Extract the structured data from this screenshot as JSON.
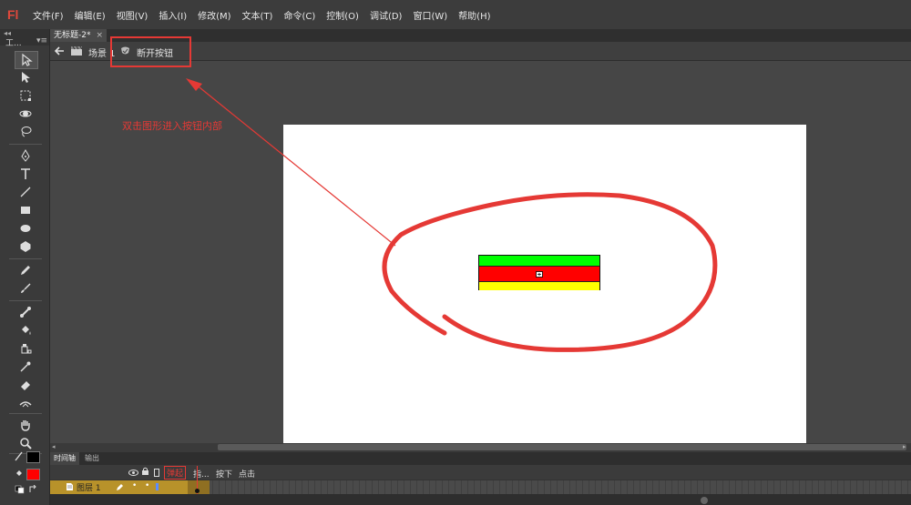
{
  "app": {
    "logo": "Fl"
  },
  "menu": [
    "文件(F)",
    "编辑(E)",
    "视图(V)",
    "插入(I)",
    "修改(M)",
    "文本(T)",
    "命令(C)",
    "控制(O)",
    "调试(D)",
    "窗口(W)",
    "帮助(H)"
  ],
  "tools_panel": {
    "title": "工...",
    "collapse": "◂◂",
    "menu_glyph": "▾≡"
  },
  "document": {
    "tab_title": "无标题-2*",
    "tab_close": "×"
  },
  "edit_bar": {
    "scene_label": "场景 1",
    "symbol_label": "断开按钮"
  },
  "annotation": {
    "text": "双击图形进入按钮内部"
  },
  "timeline": {
    "tabs": [
      "时间轴",
      "输出"
    ],
    "states": [
      "弹起",
      "指...",
      "按下",
      "点击"
    ],
    "layer_name": "图层 1",
    "layer_number": "1"
  },
  "colors": {
    "stroke": "#000000",
    "fill": "#ff0000",
    "button_top": "#00ff00",
    "button_middle": "#ff0000",
    "button_bottom": "#ffff00",
    "annotation": "#e53935"
  },
  "icons": {
    "back": "back-arrow-icon",
    "scene": "clapperboard-icon",
    "symbol": "button-symbol-icon",
    "eye": "eye-icon",
    "lock": "lock-icon",
    "outline": "outline-icon",
    "pencil": "pencil-icon"
  }
}
